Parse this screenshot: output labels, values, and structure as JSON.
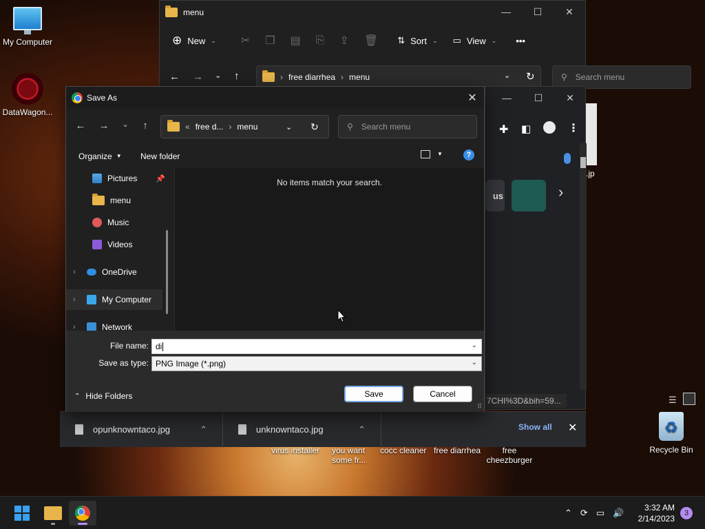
{
  "desktop": {
    "icons": [
      {
        "label": "My Computer"
      },
      {
        "label": "DataWagon..."
      },
      {
        "label": "Recycle Bin"
      }
    ],
    "captions": [
      "virus installer",
      "you want some fr...",
      "cocc cleaner",
      "free diarrhea",
      "free cheezburger"
    ]
  },
  "explorer": {
    "title": "menu",
    "toolbar": {
      "new": "New",
      "sort": "Sort",
      "view": "View",
      "more": "•••"
    },
    "breadcrumb": [
      "free diarrhea",
      "menu"
    ],
    "search_placeholder": "Search menu",
    "side_fragments": {
      "file_ext": ".jp"
    }
  },
  "browser": {
    "chip_text": "us",
    "url_fragment": "7CHI%3D&bih=59..."
  },
  "downloads": {
    "items": [
      {
        "name": "opunknowntaco.jpg"
      },
      {
        "name": "unknowntaco.jpg"
      }
    ],
    "show_all": "Show all"
  },
  "dialog": {
    "title": "Save As",
    "breadcrumb": {
      "prefix": "«",
      "parent": "free d...",
      "current": "menu"
    },
    "search_placeholder": "Search menu",
    "organize": "Organize",
    "new_folder": "New folder",
    "nav_items": [
      {
        "label": "Pictures"
      },
      {
        "label": "menu"
      },
      {
        "label": "Music"
      },
      {
        "label": "Videos"
      },
      {
        "label": "OneDrive"
      },
      {
        "label": "My Computer"
      },
      {
        "label": "Network"
      }
    ],
    "empty_message": "No items match your search.",
    "file_name_label": "File name:",
    "file_name_value": "di",
    "save_type_label": "Save as type:",
    "save_type_value": "PNG Image (*.png)",
    "hide_folders": "Hide Folders",
    "save_button": "Save",
    "cancel_button": "Cancel"
  },
  "taskbar": {
    "time": "3:32 AM",
    "date": "2/14/2023",
    "notifications": "3"
  },
  "colors": {
    "accent": "#3aa0f0",
    "folder": "#e8b54a",
    "help": "#3a8ee6"
  }
}
